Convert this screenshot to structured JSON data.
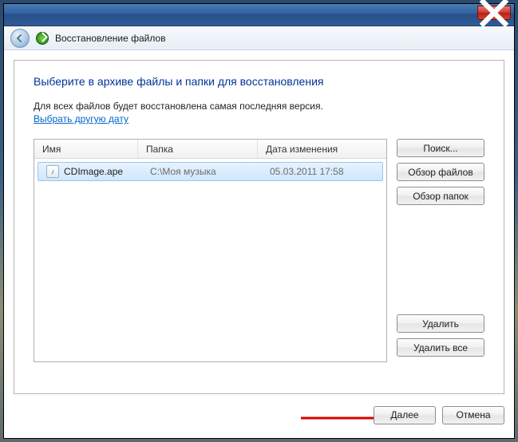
{
  "window": {
    "title": "Восстановление файлов"
  },
  "page": {
    "heading": "Выберите в архиве файлы и папки для восстановления",
    "description": "Для всех файлов будет восстановлена самая последняя версия.",
    "choose_date_link": "Выбрать другую дату"
  },
  "columns": {
    "name": "Имя",
    "folder": "Папка",
    "date": "Дата изменения"
  },
  "files": [
    {
      "name": "CDImage.ape",
      "folder": "C:\\Моя музыка",
      "date": "05.03.2011 17:58"
    }
  ],
  "buttons": {
    "search": "Поиск...",
    "browse_files": "Обзор файлов",
    "browse_folders": "Обзор папок",
    "remove": "Удалить",
    "remove_all": "Удалить все",
    "next": "Далее",
    "cancel": "Отмена"
  }
}
